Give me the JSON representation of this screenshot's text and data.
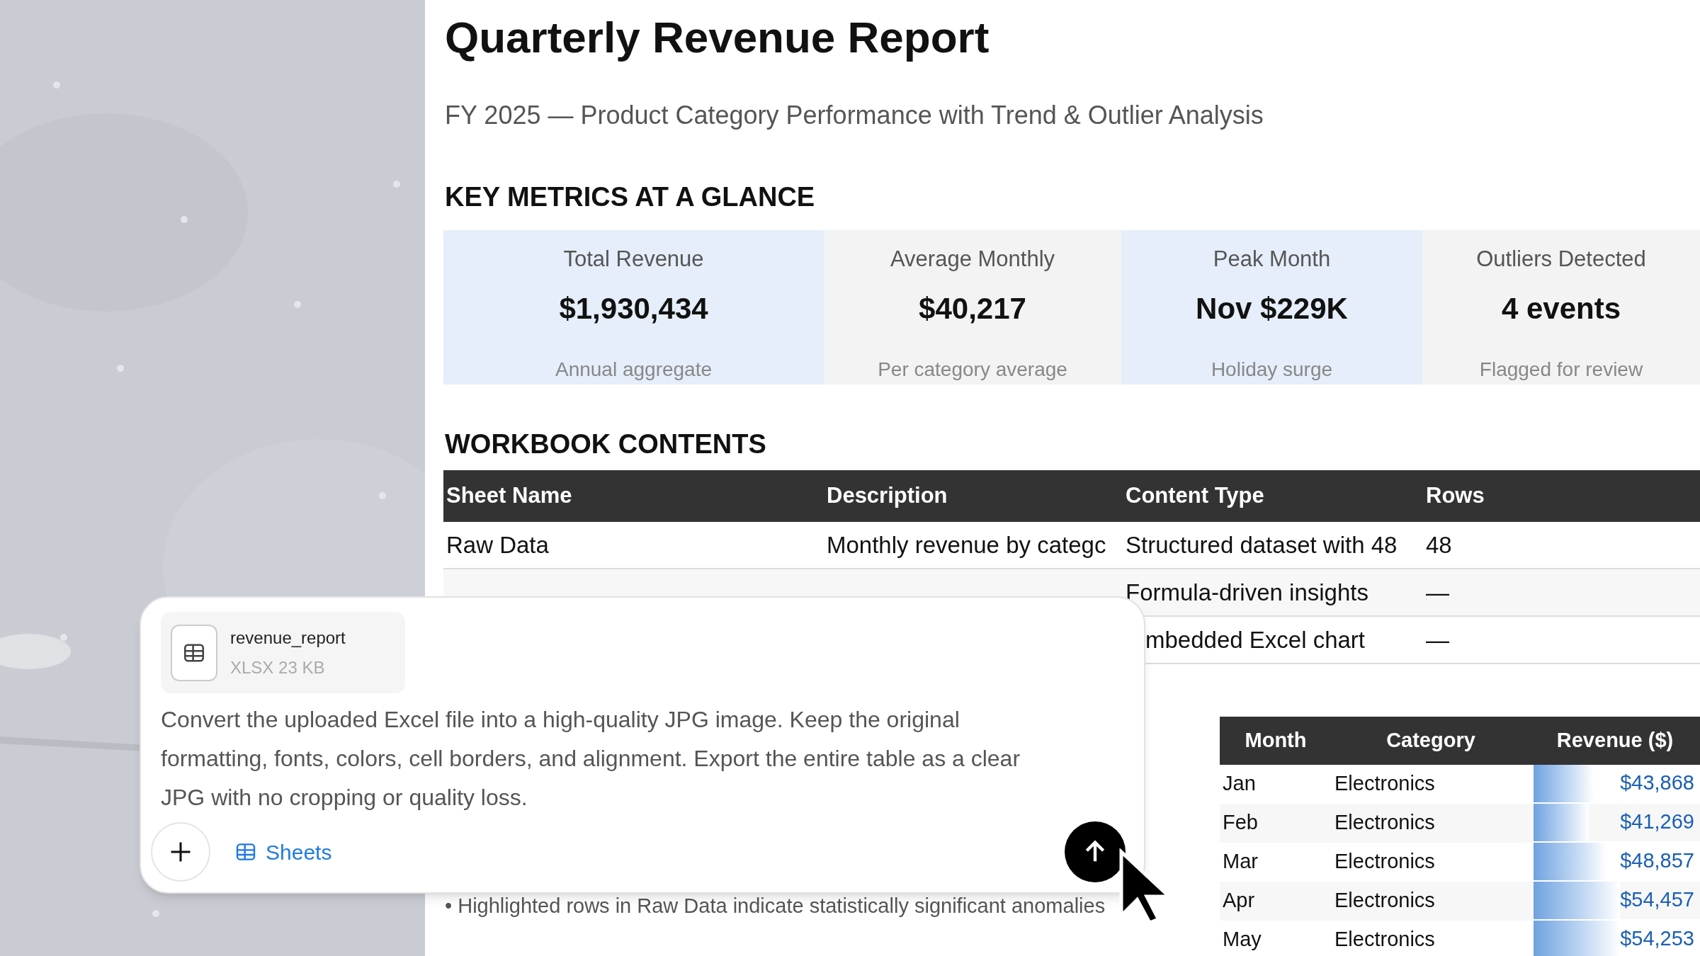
{
  "report": {
    "title": "Quarterly Revenue Report",
    "subtitle": "FY 2025 — Product Category Performance with Trend & Outlier Analysis"
  },
  "key_metrics": {
    "heading": "KEY METRICS AT A GLANCE",
    "cards": [
      {
        "label": "Total Revenue",
        "value": "$1,930,434",
        "note": "Annual aggregate",
        "color": "#e5eefa"
      },
      {
        "label": "Average Monthly",
        "value": "$40,217",
        "note": "Per category average",
        "color": "#f3f3f3"
      },
      {
        "label": "Peak Month",
        "value": "Nov $229K",
        "note": "Holiday surge",
        "color": "#e5eefa"
      },
      {
        "label": "Outliers Detected",
        "value": "4 events",
        "note": "Flagged for review",
        "color": "#f3f3f3"
      }
    ]
  },
  "workbook_contents": {
    "heading": "WORKBOOK CONTENTS",
    "columns": [
      "Sheet Name",
      "Description",
      "Content Type",
      "Rows"
    ],
    "rows": [
      {
        "sheet_name": "Raw Data",
        "description": "Monthly revenue by categc",
        "content_type": "Structured dataset with 48",
        "rows": "48"
      },
      {
        "content_type": "Formula-driven insights",
        "rows": "—"
      },
      {
        "content_type": "mbedded Excel chart",
        "rows": "—"
      }
    ]
  },
  "revenue_table": {
    "columns": [
      "Month",
      "Category",
      "Revenue ($)"
    ],
    "rows": [
      {
        "month": "Jan",
        "category": "Electronics",
        "revenue": "$43,868",
        "level": 0.36
      },
      {
        "month": "Feb",
        "category": "Electronics",
        "revenue": "$41,269",
        "level": 0.33
      },
      {
        "month": "Mar",
        "category": "Electronics",
        "revenue": "$48,857",
        "level": 0.44
      },
      {
        "month": "Apr",
        "category": "Electronics",
        "revenue": "$54,457",
        "level": 0.52
      },
      {
        "month": "May",
        "category": "Electronics",
        "revenue": "$54,253",
        "level": 0.52
      }
    ]
  },
  "note_bullet": "•",
  "note": "Highlighted rows in Raw Data indicate statistically significant anomalies",
  "composer": {
    "attachment": {
      "name": "revenue_report",
      "meta": "XLSX 23 KB"
    },
    "prompt": "Convert the uploaded Excel file into a high-quality JPG image. Keep the original formatting, fonts, colors, cell borders, and alignment. Export the entire table as a clear JPG with no cropping or quality loss.",
    "tool": "Sheets"
  }
}
